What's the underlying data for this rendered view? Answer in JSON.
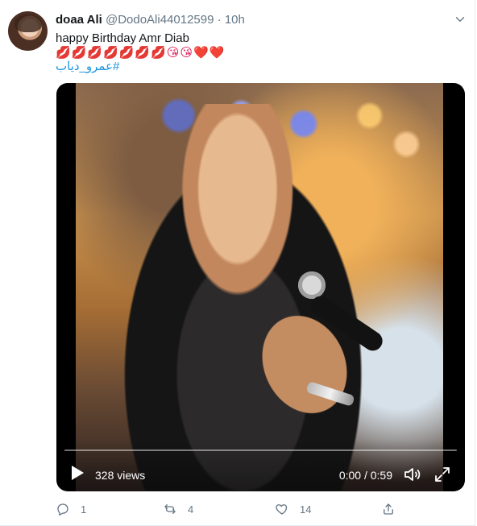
{
  "tweet": {
    "author_name": "doaa Ali",
    "author_handle": "@DodoAli44012599",
    "separator": "·",
    "time": "10h",
    "text": "happy Birthday Amr Diab",
    "emoji_line": "💋💋💋💋💋💋💋😘😘❤️❤️",
    "hashtag": "#عمرو_دياب",
    "video": {
      "views": "328 views",
      "timecode": "0:00 / 0:59",
      "progress": 0
    },
    "actions": {
      "reply_count": "1",
      "retweet_count": "4",
      "like_count": "14"
    },
    "icons": {
      "avatar": "avatar",
      "menu": "chevron-down-icon",
      "play": "play-icon",
      "volume": "volume-icon",
      "fullscreen": "fullscreen-icon",
      "reply": "reply-icon",
      "retweet": "retweet-icon",
      "like": "heart-icon",
      "share": "share-icon"
    },
    "colors": {
      "link": "#1b95e0",
      "secondary_text": "#657786",
      "primary_text": "#14171a"
    }
  }
}
